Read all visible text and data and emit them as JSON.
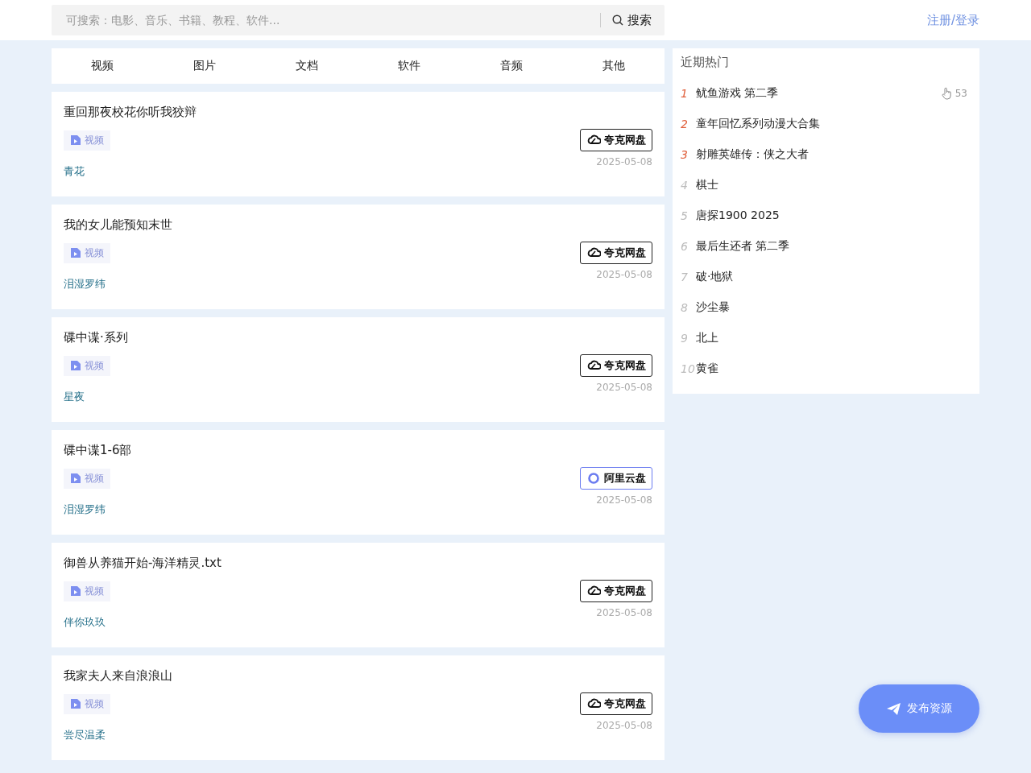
{
  "header": {
    "search": {
      "placeholder": "可搜索：电影、音乐、书籍、教程、软件...",
      "button": "搜索"
    },
    "auth_link": "注册/登录"
  },
  "category_tabs": [
    "视频",
    "图片",
    "文档",
    "软件",
    "音频",
    "其他"
  ],
  "resources": [
    {
      "title": "重回那夜校花你听我狡辩",
      "tag": "视频",
      "disk": {
        "kind": "quark",
        "label": "夸克网盘"
      },
      "author": "青花",
      "date": "2025-05-08"
    },
    {
      "title": "我的女儿能预知末世",
      "tag": "视频",
      "disk": {
        "kind": "quark",
        "label": "夸克网盘"
      },
      "author": "泪湿罗纬",
      "date": "2025-05-08"
    },
    {
      "title": "碟中谍·系列",
      "tag": "视频",
      "disk": {
        "kind": "quark",
        "label": "夸克网盘"
      },
      "author": "星夜",
      "date": "2025-05-08"
    },
    {
      "title": "碟中谍1-6部",
      "tag": "视频",
      "disk": {
        "kind": "aliyun",
        "label": "阿里云盘"
      },
      "author": "泪湿罗纬",
      "date": "2025-05-08"
    },
    {
      "title": "御兽从养猫开始-海洋精灵.txt",
      "tag": "视频",
      "disk": {
        "kind": "quark",
        "label": "夸克网盘"
      },
      "author": "伴你玖玖",
      "date": "2025-05-08"
    },
    {
      "title": "我家夫人来自浪浪山",
      "tag": "视频",
      "disk": {
        "kind": "quark",
        "label": "夸克网盘"
      },
      "author": "尝尽温柔",
      "date": "2025-05-08"
    }
  ],
  "hot": {
    "title": "近期热门",
    "items": [
      {
        "rank": "1",
        "title": "鱿鱼游戏 第二季",
        "top": true,
        "clicks": "53"
      },
      {
        "rank": "2",
        "title": "童年回忆系列动漫大合集",
        "top": true
      },
      {
        "rank": "3",
        "title": "射雕英雄传：侠之大者",
        "top": true
      },
      {
        "rank": "4",
        "title": "棋士",
        "top": false
      },
      {
        "rank": "5",
        "title": "唐探1900 2025",
        "top": false
      },
      {
        "rank": "6",
        "title": "最后生还者 第二季",
        "top": false
      },
      {
        "rank": "7",
        "title": "破·地狱",
        "top": false
      },
      {
        "rank": "8",
        "title": "沙尘暴",
        "top": false
      },
      {
        "rank": "9",
        "title": "北上",
        "top": false
      },
      {
        "rank": "10",
        "title": "黄雀",
        "top": false
      }
    ]
  },
  "publish_button": "发布资源"
}
